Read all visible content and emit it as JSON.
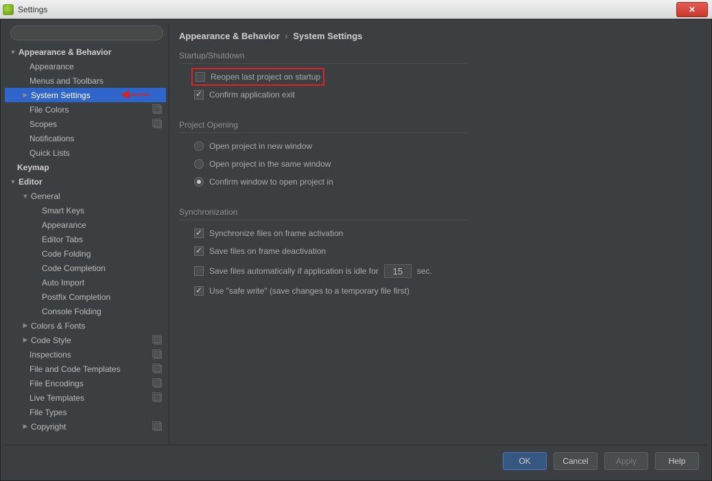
{
  "window": {
    "title": "Settings"
  },
  "breadcrumb": {
    "parent": "Appearance & Behavior",
    "current": "System Settings"
  },
  "search": {
    "placeholder": ""
  },
  "tree": [
    {
      "label": "Appearance & Behavior",
      "indent": 0,
      "bold": true,
      "arrow": "down"
    },
    {
      "label": "Appearance",
      "indent": 1
    },
    {
      "label": "Menus and Toolbars",
      "indent": 1
    },
    {
      "label": "System Settings",
      "indent": 1,
      "arrow": "right",
      "selected": true,
      "pointer": true
    },
    {
      "label": "File Colors",
      "indent": 1,
      "copy": true
    },
    {
      "label": "Scopes",
      "indent": 1,
      "copy": true
    },
    {
      "label": "Notifications",
      "indent": 1
    },
    {
      "label": "Quick Lists",
      "indent": 1
    },
    {
      "label": "Keymap",
      "indent": 0,
      "bold": true
    },
    {
      "label": "Editor",
      "indent": 0,
      "bold": true,
      "arrow": "down"
    },
    {
      "label": "General",
      "indent": 1,
      "arrow": "down"
    },
    {
      "label": "Smart Keys",
      "indent": 2
    },
    {
      "label": "Appearance",
      "indent": 2
    },
    {
      "label": "Editor Tabs",
      "indent": 2
    },
    {
      "label": "Code Folding",
      "indent": 2
    },
    {
      "label": "Code Completion",
      "indent": 2
    },
    {
      "label": "Auto Import",
      "indent": 2
    },
    {
      "label": "Postfix Completion",
      "indent": 2
    },
    {
      "label": "Console Folding",
      "indent": 2
    },
    {
      "label": "Colors & Fonts",
      "indent": 1,
      "arrow": "right"
    },
    {
      "label": "Code Style",
      "indent": 1,
      "arrow": "right",
      "copy": true
    },
    {
      "label": "Inspections",
      "indent": 1,
      "copy": true
    },
    {
      "label": "File and Code Templates",
      "indent": 1,
      "copy": true
    },
    {
      "label": "File Encodings",
      "indent": 1,
      "copy": true
    },
    {
      "label": "Live Templates",
      "indent": 1,
      "copy": true
    },
    {
      "label": "File Types",
      "indent": 1
    },
    {
      "label": "Copyright",
      "indent": 1,
      "arrow": "right",
      "copy": true
    }
  ],
  "sections": {
    "startup": {
      "title": "Startup/Shutdown",
      "items": [
        {
          "type": "checkbox",
          "label": "Reopen last project on startup",
          "checked": false,
          "highlighted": true
        },
        {
          "type": "checkbox",
          "label": "Confirm application exit",
          "checked": true
        }
      ]
    },
    "project_opening": {
      "title": "Project Opening",
      "items": [
        {
          "type": "radio",
          "label": "Open project in new window",
          "checked": false
        },
        {
          "type": "radio",
          "label": "Open project in the same window",
          "checked": false
        },
        {
          "type": "radio",
          "label": "Confirm window to open project in",
          "checked": true
        }
      ]
    },
    "sync": {
      "title": "Synchronization",
      "items": [
        {
          "type": "checkbox",
          "label": "Synchronize files on frame activation",
          "checked": true
        },
        {
          "type": "checkbox",
          "label": "Save files on frame deactivation",
          "checked": true
        },
        {
          "type": "idle",
          "label_pre": "Save files automatically if application is idle for",
          "value": "15",
          "label_post": "sec.",
          "checked": false
        },
        {
          "type": "checkbox",
          "label": "Use \"safe write\" (save changes to a temporary file first)",
          "checked": true
        }
      ]
    }
  },
  "buttons": {
    "ok": "OK",
    "cancel": "Cancel",
    "apply": "Apply",
    "help": "Help"
  }
}
